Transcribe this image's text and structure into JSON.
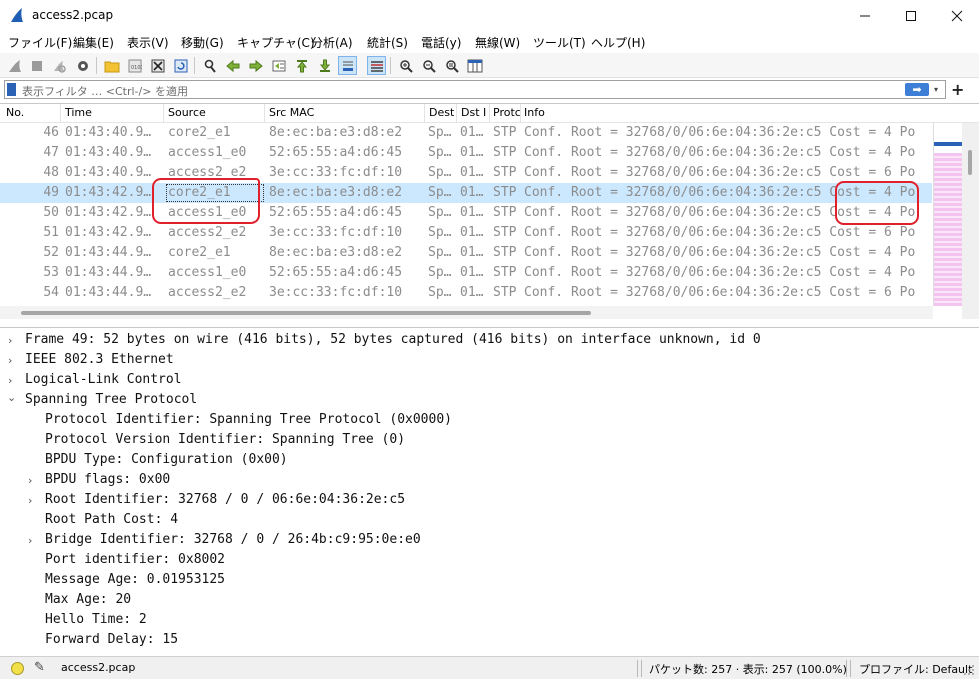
{
  "window": {
    "title": "access2.pcap"
  },
  "menu": [
    "ファイル(F)",
    "編集(E)",
    "表示(V)",
    "移動(G)",
    "キャプチャ(C)",
    "分析(A)",
    "統計(S)",
    "電話(y)",
    "無線(W)",
    "ツール(T)",
    "ヘルプ(H)"
  ],
  "filter": {
    "placeholder": "表示フィルタ … <Ctrl-/> を適用",
    "apply_arrow": "➡",
    "dropdown": "▾",
    "add": "+"
  },
  "columns": [
    "No.",
    "Time",
    "Source",
    "Src MAC",
    "Dest",
    "Dst I",
    "Protc",
    "Info"
  ],
  "packets": [
    {
      "no": "46",
      "time": "01:43:40.9…",
      "source": "core2_e1",
      "src_mac": "8e:ec:ba:e3:d8:e2",
      "dest": "Sp…",
      "dst2": "01…",
      "proto": "STP",
      "info": "Conf. Root = 32768/0/06:6e:04:36:2e:c5   Cost = 4  Po"
    },
    {
      "no": "47",
      "time": "01:43:40.9…",
      "source": "access1_e0",
      "src_mac": "52:65:55:a4:d6:45",
      "dest": "Sp…",
      "dst2": "01…",
      "proto": "STP",
      "info": "Conf. Root = 32768/0/06:6e:04:36:2e:c5   Cost = 4  Po"
    },
    {
      "no": "48",
      "time": "01:43:40.9…",
      "source": "access2_e2",
      "src_mac": "3e:cc:33:fc:df:10",
      "dest": "Sp…",
      "dst2": "01…",
      "proto": "STP",
      "info": "Conf. Root = 32768/0/06:6e:04:36:2e:c5   Cost = 6  Po"
    },
    {
      "no": "49",
      "time": "01:43:42.9…",
      "source": "core2_e1",
      "src_mac": "8e:ec:ba:e3:d8:e2",
      "dest": "Sp…",
      "dst2": "01…",
      "proto": "STP",
      "info": "Conf. Root = 32768/0/06:6e:04:36:2e:c5   Cost = 4  Po"
    },
    {
      "no": "50",
      "time": "01:43:42.9…",
      "source": "access1_e0",
      "src_mac": "52:65:55:a4:d6:45",
      "dest": "Sp…",
      "dst2": "01…",
      "proto": "STP",
      "info": "Conf. Root = 32768/0/06:6e:04:36:2e:c5   Cost = 4  Po"
    },
    {
      "no": "51",
      "time": "01:43:42.9…",
      "source": "access2_e2",
      "src_mac": "3e:cc:33:fc:df:10",
      "dest": "Sp…",
      "dst2": "01…",
      "proto": "STP",
      "info": "Conf. Root = 32768/0/06:6e:04:36:2e:c5   Cost = 6  Po"
    },
    {
      "no": "52",
      "time": "01:43:44.9…",
      "source": "core2_e1",
      "src_mac": "8e:ec:ba:e3:d8:e2",
      "dest": "Sp…",
      "dst2": "01…",
      "proto": "STP",
      "info": "Conf. Root = 32768/0/06:6e:04:36:2e:c5   Cost = 4  Po"
    },
    {
      "no": "53",
      "time": "01:43:44.9…",
      "source": "access1_e0",
      "src_mac": "52:65:55:a4:d6:45",
      "dest": "Sp…",
      "dst2": "01…",
      "proto": "STP",
      "info": "Conf. Root = 32768/0/06:6e:04:36:2e:c5   Cost = 4  Po"
    },
    {
      "no": "54",
      "time": "01:43:44.9…",
      "source": "access2_e2",
      "src_mac": "3e:cc:33:fc:df:10",
      "dest": "Sp…",
      "dst2": "01…",
      "proto": "STP",
      "info": "Conf. Root = 32768/0/06:6e:04:36:2e:c5   Cost = 6  Po"
    }
  ],
  "selected_packet": "49",
  "details": [
    {
      "text": "Frame 49: 52 bytes on wire (416 bits), 52 bytes captured (416 bits) on interface unknown, id 0",
      "arrow": "›"
    },
    {
      "text": "IEEE 802.3 Ethernet",
      "arrow": "›"
    },
    {
      "text": "Logical-Link Control",
      "arrow": "›"
    },
    {
      "text": "Spanning Tree Protocol",
      "arrow": "⌄"
    },
    {
      "text": "Protocol Identifier: Spanning Tree Protocol (0x0000)",
      "arrow": ""
    },
    {
      "text": "Protocol Version Identifier: Spanning Tree (0)",
      "arrow": ""
    },
    {
      "text": "BPDU Type: Configuration (0x00)",
      "arrow": ""
    },
    {
      "text": "BPDU flags: 0x00",
      "arrow": "›"
    },
    {
      "text": "Root Identifier: 32768 / 0 / 06:6e:04:36:2e:c5",
      "arrow": "›"
    },
    {
      "text": "Root Path Cost: 4",
      "arrow": ""
    },
    {
      "text": "Bridge Identifier: 32768 / 0 / 26:4b:c9:95:0e:e0",
      "arrow": "›"
    },
    {
      "text": "Port identifier: 0x8002",
      "arrow": ""
    },
    {
      "text": "Message Age: 0.01953125",
      "arrow": ""
    },
    {
      "text": "Max Age: 20",
      "arrow": ""
    },
    {
      "text": "Hello Time: 2",
      "arrow": ""
    },
    {
      "text": "Forward Delay: 15",
      "arrow": ""
    }
  ],
  "status": {
    "file": "access2.pcap",
    "packets": "パケット数: 257 · 表示: 257 (100.0%)",
    "profile": "プロファイル: Default"
  },
  "colors": {
    "selected_row": "#cce8ff",
    "annotation": "#e0202b",
    "minimap_stripe": "#f5c6f0",
    "row_text": "#8c8c8c"
  }
}
